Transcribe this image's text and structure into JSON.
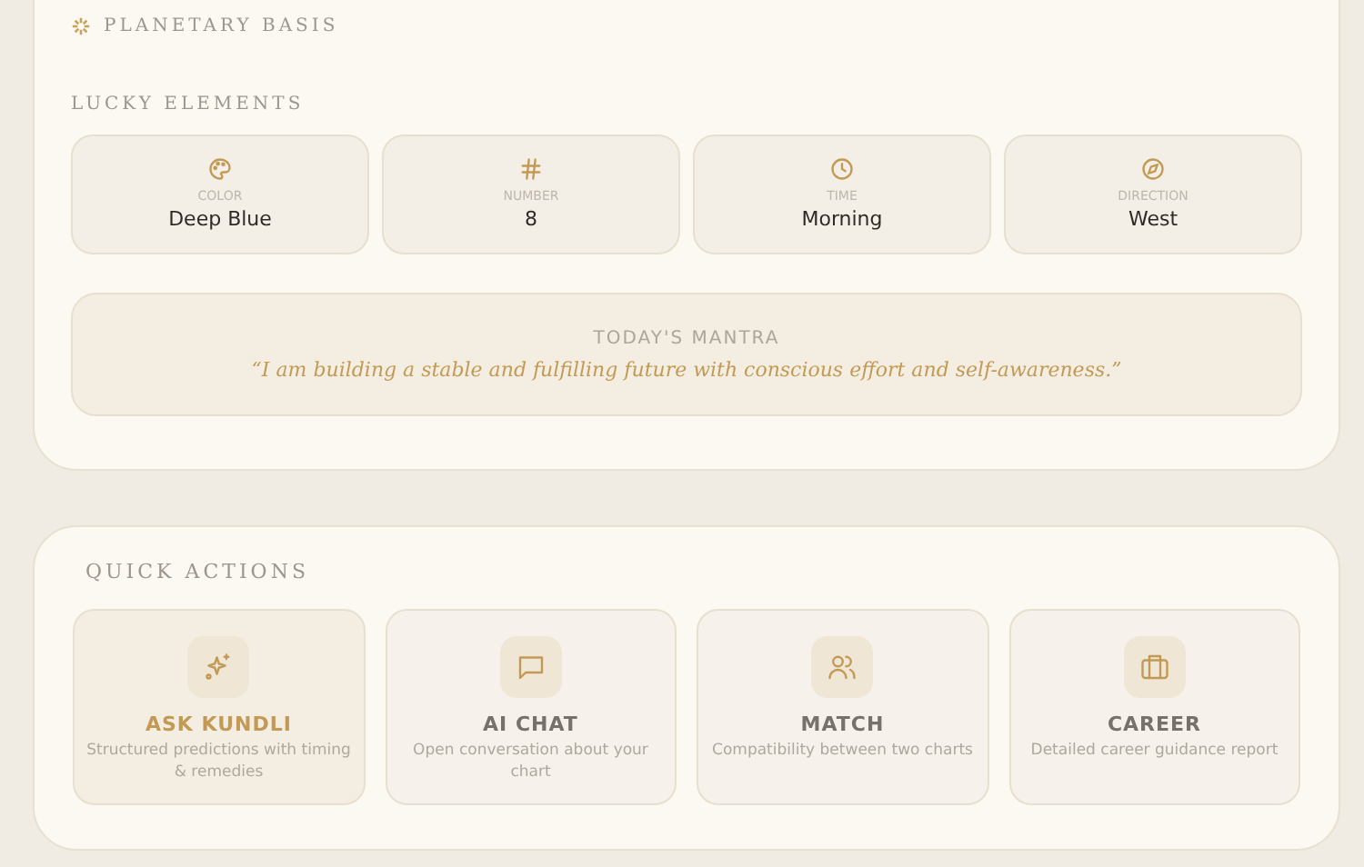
{
  "planetary_basis": {
    "title": "PLANETARY BASIS"
  },
  "lucky_elements": {
    "title": "LUCKY ELEMENTS",
    "items": [
      {
        "kind": "color",
        "label": "COLOR",
        "value": "Deep Blue"
      },
      {
        "kind": "number",
        "label": "NUMBER",
        "value": "8"
      },
      {
        "kind": "time",
        "label": "TIME",
        "value": "Morning"
      },
      {
        "kind": "direction",
        "label": "DIRECTION",
        "value": "West"
      }
    ],
    "mantra": {
      "label": "TODAY'S MANTRA",
      "text": "“I am building a stable and fulfilling future with conscious effort and self-awareness.”"
    }
  },
  "quick_actions": {
    "title": "QUICK ACTIONS",
    "items": [
      {
        "kind": "sparkles",
        "title": "ASK KUNDLI",
        "description": "Structured predictions with timing & remedies",
        "selected": true
      },
      {
        "kind": "chat",
        "title": "AI CHAT",
        "description": "Open conversation about your chart",
        "selected": false
      },
      {
        "kind": "people",
        "title": "MATCH",
        "description": "Compatibility between two charts",
        "selected": false
      },
      {
        "kind": "briefcase",
        "title": "CAREER",
        "description": "Detailed career guidance report",
        "selected": false
      }
    ]
  }
}
